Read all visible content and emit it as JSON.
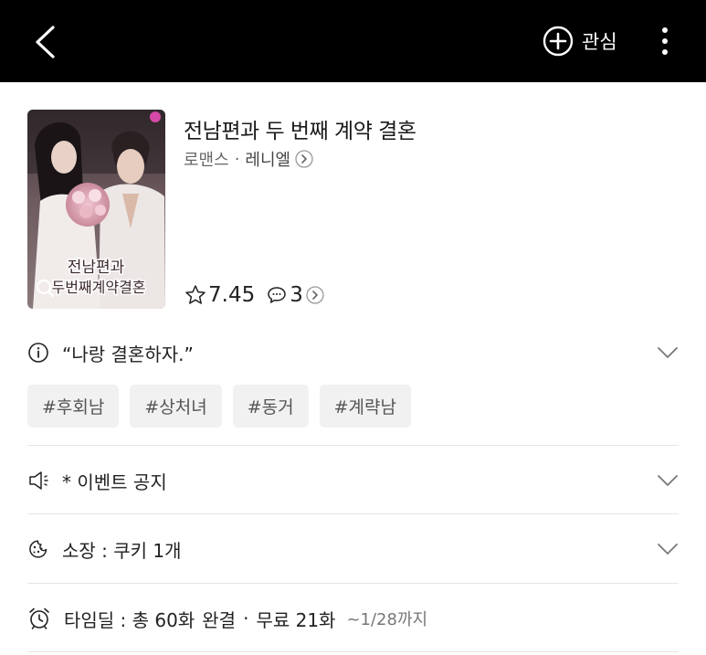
{
  "header": {
    "favorite_label": "관심"
  },
  "work": {
    "cover_text": "전남편과 두 번째 계약결혼",
    "title": "전남편과 두 번째 계약 결혼",
    "genre": "로맨스",
    "separator": "·",
    "author": "레니엘",
    "rating": "7.45",
    "comments": "3"
  },
  "synopsis": {
    "text": "“나랑 결혼하자.”"
  },
  "tags": [
    "#후회남",
    "#상처녀",
    "#동거",
    "#계략남"
  ],
  "event": {
    "text": "* 이벤트 공지"
  },
  "owned": {
    "text": "소장 : 쿠키 1개"
  },
  "timedeal": {
    "prefix": "타임딜 : 총 60화",
    "status": "완결",
    "dot": "·",
    "free": "무료 21화",
    "until": "~1/28까지"
  },
  "colors": {
    "header_bg": "#000000",
    "accent_green": "#0eaa58",
    "tag_bg": "#f1f1f1"
  }
}
